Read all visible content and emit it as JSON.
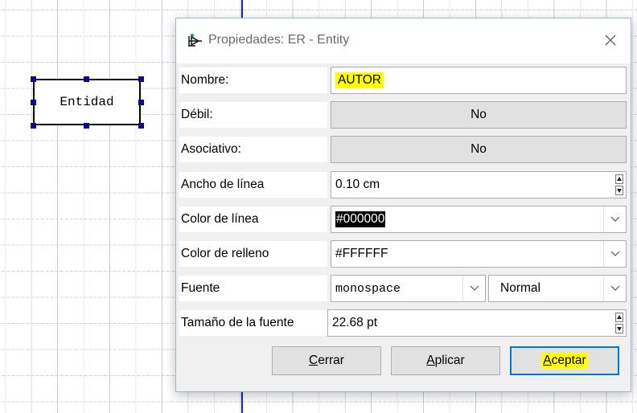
{
  "canvas": {
    "entity_label": "Entidad"
  },
  "dialog": {
    "title": "Propiedades: ER - Entity",
    "close_glyph": "✕",
    "rows": {
      "nombre": {
        "label": "Nombre:",
        "value": "AUTOR"
      },
      "debil": {
        "label": "Débil:",
        "value": "No"
      },
      "asociativo": {
        "label": "Asociativo:",
        "value": "No"
      },
      "ancho_linea": {
        "label": "Ancho de línea",
        "value": "0.10 cm"
      },
      "color_linea": {
        "label": "Color de línea",
        "value": "#000000"
      },
      "color_relleno": {
        "label": "Color de relleno",
        "value": "#FFFFFF"
      },
      "fuente": {
        "label": "Fuente",
        "family": "monospace",
        "style": "Normal"
      },
      "tamano_fuente": {
        "label": "Tamaño de la fuente",
        "value": "22.68 pt"
      }
    },
    "buttons": {
      "cerrar": {
        "first": "C",
        "rest": "errar"
      },
      "aplicar": {
        "first": "A",
        "rest": "plicar"
      },
      "aceptar": {
        "first": "A",
        "rest": "ceptar"
      }
    }
  },
  "colors": {
    "accent": "#0078d7",
    "highlight": "#ffff00",
    "guide_line": "#1b2a9e",
    "handle": "#0a0a8a"
  },
  "icons": {
    "title": "er-diagram-icon",
    "close": "close-icon",
    "dropdown": "chevron-down-icon",
    "spinner": "spinner-arrows-icon"
  }
}
